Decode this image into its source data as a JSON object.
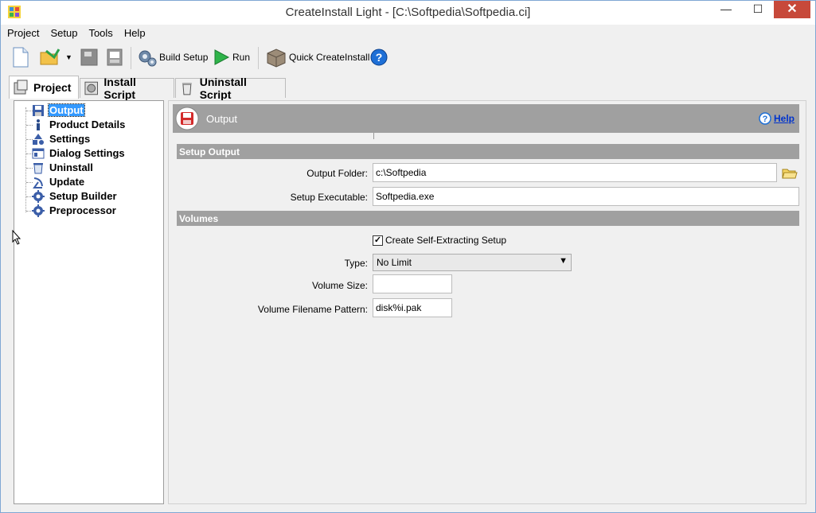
{
  "window": {
    "title": "CreateInstall Light - [C:\\Softpedia\\Softpedia.ci]",
    "minimize": "—",
    "maximize": "☐",
    "close": "✕"
  },
  "menu": [
    "Project",
    "Setup",
    "Tools",
    "Help"
  ],
  "toolbar": {
    "build_setup": "Build Setup",
    "run": "Run",
    "quick_createinstall": "Quick CreateInstall"
  },
  "tabs": [
    {
      "label": "Project",
      "active": true
    },
    {
      "label": "Install Script",
      "active": false
    },
    {
      "label": "Uninstall Script",
      "active": false
    }
  ],
  "tree": [
    {
      "label": "Output",
      "icon": "floppy-icon",
      "selected": true
    },
    {
      "label": "Product Details",
      "icon": "info-icon",
      "selected": false
    },
    {
      "label": "Settings",
      "icon": "shapes-icon",
      "selected": false
    },
    {
      "label": "Dialog Settings",
      "icon": "dialog-icon",
      "selected": false
    },
    {
      "label": "Uninstall",
      "icon": "uninstall-icon",
      "selected": false
    },
    {
      "label": "Update",
      "icon": "satellite-icon",
      "selected": false
    },
    {
      "label": "Setup Builder",
      "icon": "gear-icon",
      "selected": false
    },
    {
      "label": "Preprocessor",
      "icon": "gear-icon",
      "selected": false
    }
  ],
  "panel": {
    "title": "Output",
    "help_label": "Help",
    "setup_output_header": "Setup Output",
    "output_folder_label": "Output Folder:",
    "output_folder_value": "c:\\Softpedia",
    "setup_executable_label": "Setup Executable:",
    "setup_executable_value": "Softpedia.exe",
    "volumes_header": "Volumes",
    "self_extracting_label": "Create Self-Extracting Setup",
    "self_extracting_checked": true,
    "type_label": "Type:",
    "type_value": "No Limit",
    "volume_size_label": "Volume Size:",
    "volume_size_value": "",
    "volume_pattern_label": "Volume Filename Pattern:",
    "volume_pattern_value": "disk%i.pak"
  },
  "colors": {
    "section_header_bg": "#a0a0a0",
    "selection": "#3399ff",
    "close_button": "#c7493a",
    "help_link": "#0033cc"
  }
}
